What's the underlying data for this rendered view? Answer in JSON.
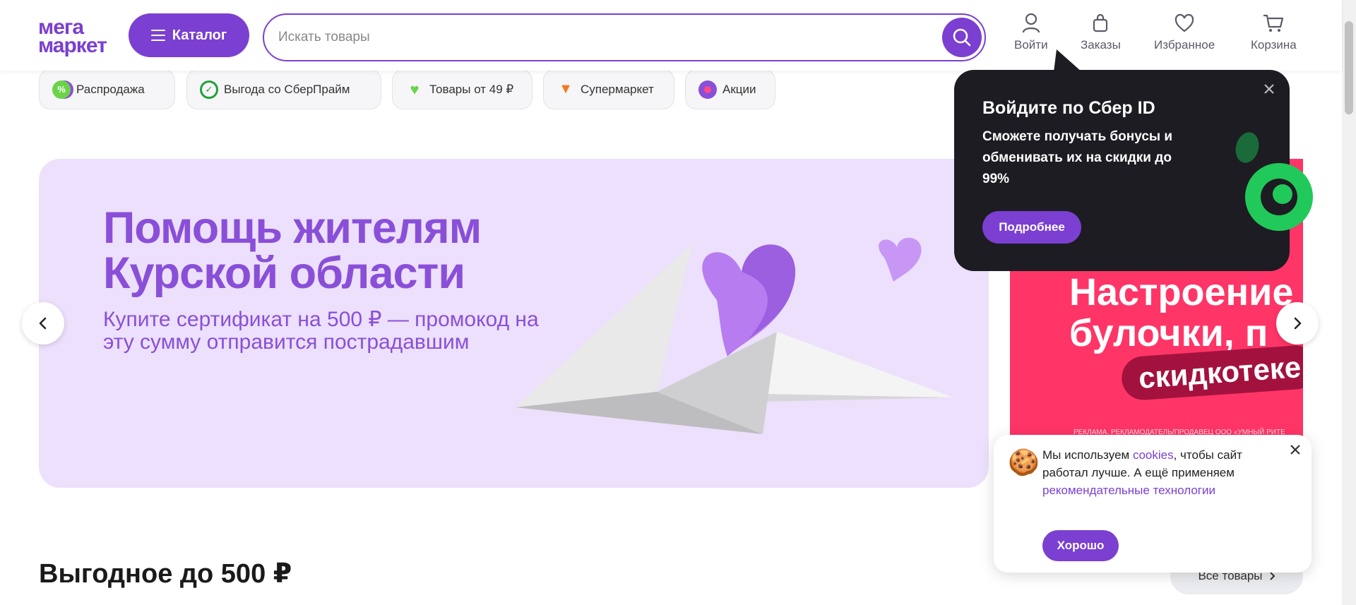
{
  "header": {
    "logo_line1": "мега",
    "logo_line2": "маркет",
    "catalog_label": "Каталог",
    "search_placeholder": "Искать товары",
    "nav": {
      "login": "Войти",
      "orders": "Заказы",
      "favorites": "Избранное",
      "cart": "Корзина"
    }
  },
  "chips": [
    {
      "label": "Распродажа",
      "icon": "percent-icon"
    },
    {
      "label": "Выгода со СберПрайм",
      "icon": "check-icon"
    },
    {
      "label": "Товары от 49 ₽",
      "icon": "heart-icon"
    },
    {
      "label": "Супермаркет",
      "icon": "carrot-icon"
    },
    {
      "label": "Акции",
      "icon": "fire-icon"
    }
  ],
  "banner": {
    "title_line1": "Помощь жителям",
    "title_line2": "Курской области",
    "subtitle": "Купите сертификат на 500 ₽ — промокод на эту сумму отправится пострадавшим"
  },
  "promo2": {
    "line1": "Настроение",
    "line2": "булочки, п",
    "pill": "скидкотеке",
    "ad_note": "РЕКЛАМА. РЕКЛАМОДАТЕЛЬ/ПРОДАВЕЦ ООО «УМНЫЙ РИТЕ"
  },
  "tooltip": {
    "title": "Войдите по Сбер ID",
    "text": "Сможете получать бонусы и обменивать их на скидки до 99%",
    "button": "Подробнее"
  },
  "section": {
    "title": "Выгодное до 500 ₽",
    "all_button": "Все товары"
  },
  "cookie": {
    "text_part1": "Мы используем ",
    "link1": "cookies",
    "text_part2": ", чтобы сайт работал лучше. А ещё применяем ",
    "link2": "рекомендательные технологии",
    "button": "Хорошо"
  },
  "colors": {
    "accent": "#7b3fd1",
    "banner_bg": "#ece0fc",
    "promo_bg": "#ff3567",
    "tooltip_bg": "#1c1c22"
  }
}
